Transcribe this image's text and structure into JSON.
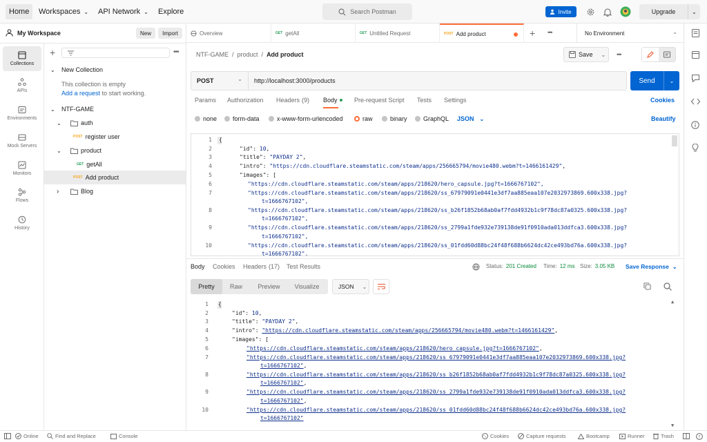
{
  "header": {
    "home": "Home",
    "workspaces": "Workspaces",
    "api_network": "API Network",
    "explore": "Explore",
    "search_placeholder": "Search Postman",
    "invite": "Invite",
    "upgrade": "Upgrade"
  },
  "sidebar": {
    "workspace_name": "My Workspace",
    "new_btn": "New",
    "import_btn": "Import",
    "rail": [
      {
        "label": "Collections",
        "icon": "collections-icon"
      },
      {
        "label": "APIs",
        "icon": "apis-icon"
      },
      {
        "label": "Environments",
        "icon": "environments-icon"
      },
      {
        "label": "Mock Servers",
        "icon": "mock-servers-icon"
      },
      {
        "label": "Monitors",
        "icon": "monitors-icon"
      },
      {
        "label": "Flows",
        "icon": "flows-icon"
      },
      {
        "label": "History",
        "icon": "history-icon"
      }
    ],
    "new_collection": "New Collection",
    "empty_text": "This collection is empty",
    "add_request": "Add a request",
    "to_start": "to start working.",
    "ntf_game": "NTF-GAME",
    "auth": "auth",
    "register_method": "POST",
    "register_user": "register user",
    "product": "product",
    "getall_method": "GET",
    "getall": "getAll",
    "add_method": "POST",
    "add_product": "Add product",
    "blog": "Blog"
  },
  "tabs": {
    "overview": "Overview",
    "t1_method": "GET",
    "t1_label": "getAll",
    "t2_method": "GET",
    "t2_label": "Untitled Request",
    "t3_method": "POST",
    "t3_label": "Add product",
    "environment": "No Environment"
  },
  "request": {
    "crumb1": "NTF-GAME",
    "sep1": "/",
    "crumb2": "product",
    "sep2": "/",
    "crumb3": "Add product",
    "save": "Save",
    "method": "POST",
    "url": "http://localhost:3000/products",
    "send": "Send",
    "tabs": {
      "params": "Params",
      "authorization": "Authorization",
      "headers": "Headers",
      "headers_count": "(9)",
      "body": "Body",
      "prerequest": "Pre-request Script",
      "tests": "Tests",
      "settings": "Settings",
      "cookies": "Cookies"
    },
    "body_types": {
      "none": "none",
      "formdata": "form-data",
      "urlencoded": "x-www-form-urlencoded",
      "raw": "raw",
      "binary": "binary",
      "graphql": "GraphQL",
      "json": "JSON",
      "beautify": "Beautify"
    }
  },
  "req_code": {
    "line_numbers": [
      "1",
      "2",
      "3",
      "4",
      "5",
      "6",
      "7",
      "8",
      "9",
      "10"
    ],
    "l1": "{",
    "l2_key": "\"id\"",
    "l2_val": "10",
    "l3_key": "\"title\"",
    "l3_val": "\"PAYDAY 2\"",
    "l4_key": "\"intro\"",
    "l4_val": "\"https://cdn.cloudflare.steamstatic.com/steam/apps/256665794/movie480.webm?t=1466161429\"",
    "l5_key": "\"images\"",
    "l5_val": "[",
    "l6": "\"https://cdn.cloudflare.steamstatic.com/steam/apps/218620/hero_capsule.jpg?t=1666767102\"",
    "l7a": "\"https://cdn.cloudflare.steamstatic.com/steam/apps/218620/ss_67979091e0441e3df7aa885eaa107e2032973869.600x338.jpg?",
    "l7b": "t=1666767102\"",
    "l8a": "\"https://cdn.cloudflare.steamstatic.com/steam/apps/218620/ss_b26f1852b68ab0af7fdd4932b1c9f78dc87a0325.600x338.jpg?",
    "l8b": "t=1666767102\"",
    "l9a": "\"https://cdn.cloudflare.steamstatic.com/steam/apps/218620/ss_2799a1fde932e739138de91f0910ada013ddfca3.600x338.jpg?",
    "l9b": "t=1666767102\"",
    "l10a": "\"https://cdn.cloudflare.steamstatic.com/steam/apps/218620/ss_01fdd60d88bc24f48f688b6624dc42ce493bd76a.600x338.jpg?",
    "l10b": "t=1666767102\""
  },
  "response": {
    "tabs": {
      "body": "Body",
      "cookies": "Cookies",
      "headers": "Headers",
      "headers_count": "(17)",
      "test_results": "Test Results"
    },
    "status_label": "Status:",
    "status_value": "201 Created",
    "time_label": "Time:",
    "time_value": "12 ms",
    "size_label": "Size:",
    "size_value": "3.05 KB",
    "save_response": "Save Response",
    "views": {
      "pretty": "Pretty",
      "raw": "Raw",
      "preview": "Preview",
      "visualize": "Visualize",
      "format": "JSON"
    }
  },
  "res_code": {
    "line_numbers": [
      "1",
      "2",
      "3",
      "4",
      "5",
      "6",
      "7",
      "8",
      "9",
      "10"
    ],
    "l1": "{",
    "l2_key": "\"id\"",
    "l2_val": "10",
    "l3_key": "\"title\"",
    "l3_val": "\"PAYDAY 2\"",
    "l4_key": "\"intro\"",
    "l4_val": "\"https://cdn.cloudflare.steamstatic.com/steam/apps/256665794/movie480.webm?t=1466161429\"",
    "l5_key": "\"images\"",
    "l5_val": "[",
    "l6": "\"https://cdn.cloudflare.steamstatic.com/steam/apps/218620/hero_capsule.jpg?t=1666767102\"",
    "l7a": "\"https://cdn.cloudflare.steamstatic.com/steam/apps/218620/ss_67979091e0441e3df7aa885eaa107e2032973869.600x338.jpg?",
    "l7b": "t=1666767102\"",
    "l8a": "\"https://cdn.cloudflare.steamstatic.com/steam/apps/218620/ss_b26f1852b68ab0af7fdd4932b1c9f78dc87a0325.600x338.jpg?",
    "l8b": "t=1666767102\"",
    "l9a": "\"https://cdn.cloudflare.steamstatic.com/steam/apps/218620/ss_2799a1fde932e739138de91f0910ada013ddfca3.600x338.jpg?",
    "l9b": "t=1666767102\"",
    "l10a": "\"https://cdn.cloudflare.steamstatic.com/steam/apps/218620/ss_01fdd60d88bc24f48f688b6624dc42ce493bd76a.600x338.jpg?",
    "l10b": "t=1666767102\""
  },
  "footer": {
    "online": "Online",
    "find_replace": "Find and Replace",
    "console": "Console",
    "cookies": "Cookies",
    "capture": "Capture requests",
    "bootcamp": "Bootcamp",
    "runner": "Runner",
    "trash": "Trash"
  },
  "colors": {
    "accent": "#0265d2",
    "post": "#f5a623",
    "get": "#27a05a",
    "status_ok": "#0a8a3a",
    "tab_indicator": "#ff6c37"
  }
}
